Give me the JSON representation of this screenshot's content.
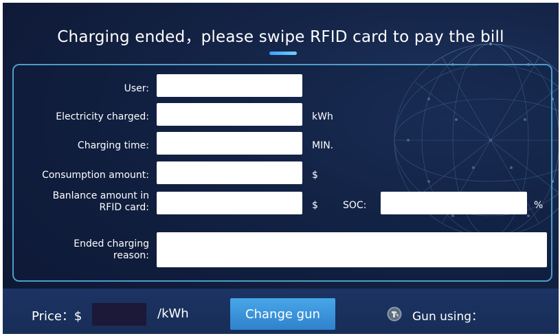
{
  "title": "Charging ended，please swipe RFID card to pay the bill",
  "form": {
    "user_label": "User:",
    "user_value": "",
    "electricity_label": "Electricity charged:",
    "electricity_value": "",
    "electricity_unit": "kWh",
    "time_label": "Charging time:",
    "time_value": "",
    "time_unit": "MIN.",
    "consumption_label": "Consumption amount:",
    "consumption_value": "",
    "consumption_unit": "$",
    "balance_label_line1": "Banlance amount in",
    "balance_label_line2": "RFID card:",
    "balance_value": "",
    "balance_unit": "$",
    "soc_label": "SOC:",
    "soc_value": "",
    "soc_unit": "%",
    "reason_label_line1": "Ended charging",
    "reason_label_line2": "reason:",
    "reason_value": ""
  },
  "bottom": {
    "price_label": "Price：$",
    "price_value": "",
    "price_unit": "/kWh",
    "change_gun_label": "Change gun",
    "gun_using_label": "Gun using：",
    "gun_icon": "charging-gun-icon"
  },
  "colors": {
    "background": "#101c3a",
    "panel_border": "#4e9ec9",
    "accent": "#3aa0ff",
    "button": "#3a94da",
    "bottom_bar": "#1c3464"
  }
}
